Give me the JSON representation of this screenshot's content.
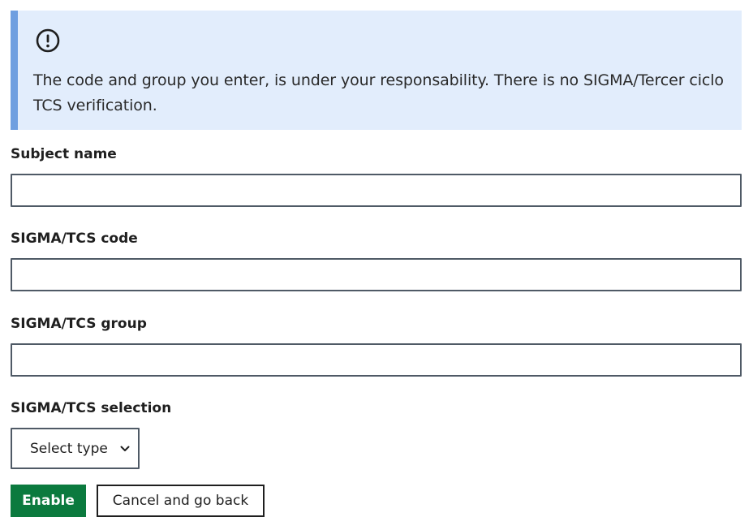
{
  "alert": {
    "icon": "exclamation-circle-icon",
    "message": "The code and group you enter, is under your responsability. There is no SIGMA/Tercer ciclo TCS verification.",
    "background_color": "#e2edfc",
    "accent_color": "#6f9fe0"
  },
  "form": {
    "subject_name": {
      "label": "Subject name",
      "value": ""
    },
    "sigma_code": {
      "label": "SIGMA/TCS code",
      "value": ""
    },
    "sigma_group": {
      "label": "SIGMA/TCS group",
      "value": ""
    },
    "sigma_selection": {
      "label": "SIGMA/TCS selection",
      "selected": "Select type",
      "icon": "chevron-down-icon"
    }
  },
  "actions": {
    "enable_label": "Enable",
    "cancel_label": "Cancel and go back",
    "primary_color": "#0b7a3e"
  }
}
